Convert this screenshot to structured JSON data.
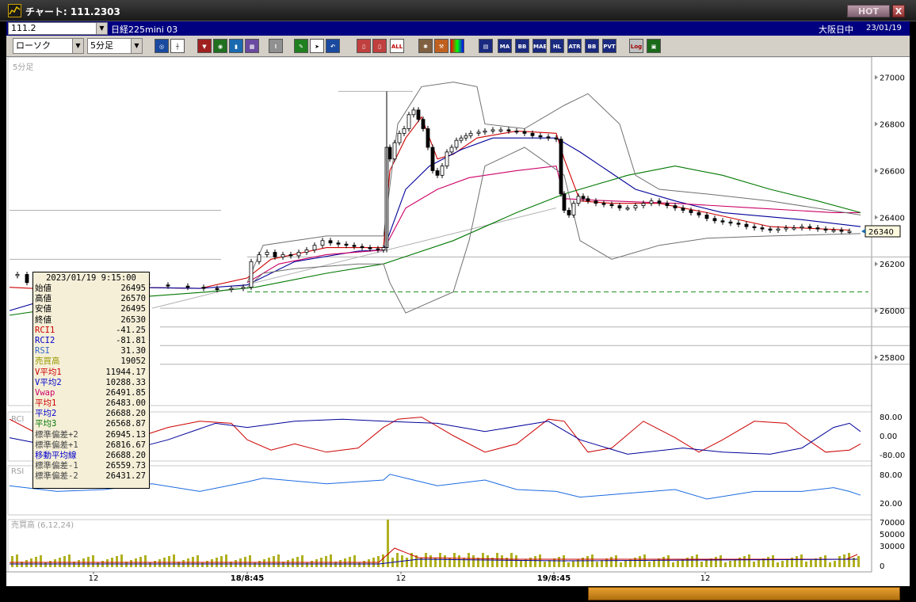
{
  "window": {
    "title": "チャート: 111.2303",
    "hot_label": "HOT",
    "close_label": "X"
  },
  "infobar": {
    "symbol": "111.2",
    "instrument": "日経225mini 03",
    "session": "大阪日中",
    "date": "23/01/19"
  },
  "toolbar": {
    "chart_type": "ローソク",
    "interval": "5分足",
    "buttons": [
      "MA",
      "BB",
      "MAE",
      "HL",
      "ATR",
      "PVT",
      "Log",
      "ALL"
    ]
  },
  "chart_data": {
    "type": "candlestick",
    "interval_label": "5分足",
    "price_axis": {
      "ticks": [
        27000,
        26800,
        26600,
        26400,
        26200,
        26000,
        25800
      ],
      "range": [
        25620,
        27060
      ]
    },
    "last_price": 26340,
    "x_ticks": [
      "12",
      "18/8:45",
      "12",
      "19/8:45",
      "12"
    ],
    "price_path": [
      [
        0,
        26150
      ],
      [
        10,
        26155
      ],
      [
        22,
        26120
      ],
      [
        40,
        26110
      ],
      [
        55,
        26105
      ],
      [
        90,
        26110
      ],
      [
        120,
        26120
      ],
      [
        150,
        26115
      ],
      [
        175,
        26110
      ],
      [
        200,
        26105
      ],
      [
        225,
        26100
      ],
      [
        245,
        26095
      ],
      [
        262,
        26090
      ],
      [
        280,
        26095
      ],
      [
        295,
        26100
      ],
      [
        305,
        26210
      ],
      [
        315,
        26240
      ],
      [
        325,
        26250
      ],
      [
        335,
        26230
      ],
      [
        345,
        26240
      ],
      [
        355,
        26235
      ],
      [
        365,
        26250
      ],
      [
        375,
        26260
      ],
      [
        385,
        26280
      ],
      [
        395,
        26300
      ],
      [
        405,
        26290
      ],
      [
        415,
        26285
      ],
      [
        425,
        26280
      ],
      [
        435,
        26275
      ],
      [
        445,
        26270
      ],
      [
        455,
        26265
      ],
      [
        465,
        26260
      ],
      [
        472,
        26270
      ],
      [
        476,
        26700
      ],
      [
        480,
        26650
      ],
      [
        486,
        26720
      ],
      [
        492,
        26760
      ],
      [
        498,
        26780
      ],
      [
        504,
        26840
      ],
      [
        510,
        26860
      ],
      [
        516,
        26820
      ],
      [
        522,
        26780
      ],
      [
        528,
        26700
      ],
      [
        534,
        26600
      ],
      [
        540,
        26580
      ],
      [
        546,
        26620
      ],
      [
        552,
        26680
      ],
      [
        558,
        26700
      ],
      [
        564,
        26730
      ],
      [
        570,
        26740
      ],
      [
        576,
        26750
      ],
      [
        582,
        26760
      ],
      [
        592,
        26765
      ],
      [
        600,
        26770
      ],
      [
        610,
        26775
      ],
      [
        620,
        26775
      ],
      [
        630,
        26770
      ],
      [
        640,
        26768
      ],
      [
        650,
        26760
      ],
      [
        660,
        26750
      ],
      [
        670,
        26745
      ],
      [
        680,
        26740
      ],
      [
        690,
        26735
      ],
      [
        696,
        26500
      ],
      [
        700,
        26430
      ],
      [
        706,
        26410
      ],
      [
        712,
        26460
      ],
      [
        718,
        26490
      ],
      [
        724,
        26480
      ],
      [
        730,
        26470
      ],
      [
        740,
        26460
      ],
      [
        750,
        26455
      ],
      [
        760,
        26450
      ],
      [
        770,
        26440
      ],
      [
        780,
        26440
      ],
      [
        790,
        26450
      ],
      [
        800,
        26460
      ],
      [
        810,
        26470
      ],
      [
        820,
        26460
      ],
      [
        830,
        26450
      ],
      [
        840,
        26440
      ],
      [
        850,
        26430
      ],
      [
        860,
        26420
      ],
      [
        870,
        26410
      ],
      [
        880,
        26395
      ],
      [
        890,
        26385
      ],
      [
        900,
        26380
      ],
      [
        910,
        26375
      ],
      [
        920,
        26370
      ],
      [
        930,
        26360
      ],
      [
        940,
        26355
      ],
      [
        950,
        26350
      ],
      [
        960,
        26345
      ],
      [
        970,
        26350
      ],
      [
        980,
        26355
      ],
      [
        990,
        26355
      ],
      [
        1000,
        26360
      ],
      [
        1010,
        26355
      ],
      [
        1020,
        26350
      ],
      [
        1030,
        26345
      ],
      [
        1040,
        26345
      ],
      [
        1050,
        26340
      ],
      [
        1060,
        26340
      ]
    ],
    "series": [
      {
        "key": "ma_fast",
        "color": "#cc0000",
        "points": [
          [
            0,
            26100
          ],
          [
            60,
            26090
          ],
          [
            150,
            26100
          ],
          [
            240,
            26095
          ],
          [
            300,
            26140
          ],
          [
            330,
            26220
          ],
          [
            400,
            26270
          ],
          [
            472,
            26270
          ],
          [
            480,
            26600
          ],
          [
            500,
            26740
          ],
          [
            520,
            26830
          ],
          [
            540,
            26650
          ],
          [
            560,
            26670
          ],
          [
            590,
            26740
          ],
          [
            640,
            26770
          ],
          [
            690,
            26760
          ],
          [
            700,
            26650
          ],
          [
            720,
            26470
          ],
          [
            760,
            26460
          ],
          [
            820,
            26460
          ],
          [
            880,
            26420
          ],
          [
            960,
            26360
          ],
          [
            1060,
            26345
          ]
        ]
      },
      {
        "key": "ma_mid",
        "color": "#000099",
        "points": [
          [
            0,
            26000
          ],
          [
            60,
            26060
          ],
          [
            150,
            26100
          ],
          [
            240,
            26095
          ],
          [
            300,
            26110
          ],
          [
            360,
            26210
          ],
          [
            440,
            26255
          ],
          [
            472,
            26260
          ],
          [
            500,
            26520
          ],
          [
            530,
            26620
          ],
          [
            570,
            26690
          ],
          [
            610,
            26740
          ],
          [
            690,
            26740
          ],
          [
            720,
            26680
          ],
          [
            790,
            26520
          ],
          [
            840,
            26470
          ],
          [
            900,
            26420
          ],
          [
            1000,
            26390
          ],
          [
            1074,
            26360
          ]
        ]
      },
      {
        "key": "vwap",
        "color": "#cc0066",
        "points": [
          [
            300,
            26120
          ],
          [
            340,
            26200
          ],
          [
            400,
            26240
          ],
          [
            472,
            26260
          ],
          [
            500,
            26440
          ],
          [
            540,
            26520
          ],
          [
            580,
            26570
          ],
          [
            640,
            26600
          ],
          [
            690,
            26620
          ],
          [
            700,
            26480
          ],
          [
            760,
            26470
          ],
          [
            840,
            26460
          ],
          [
            940,
            26440
          ],
          [
            1040,
            26420
          ],
          [
            1074,
            26420
          ]
        ]
      },
      {
        "key": "ma_slow",
        "color": "#007700",
        "points": [
          [
            0,
            25980
          ],
          [
            80,
            26020
          ],
          [
            170,
            26060
          ],
          [
            250,
            26080
          ],
          [
            310,
            26100
          ],
          [
            400,
            26160
          ],
          [
            472,
            26200
          ],
          [
            560,
            26300
          ],
          [
            640,
            26420
          ],
          [
            700,
            26500
          ],
          [
            780,
            26580
          ],
          [
            840,
            26620
          ],
          [
            900,
            26580
          ],
          [
            960,
            26520
          ],
          [
            1020,
            26470
          ],
          [
            1074,
            26420
          ]
        ]
      },
      {
        "key": "bb_upper",
        "color": "#707070",
        "points": [
          [
            300,
            26120
          ],
          [
            320,
            26280
          ],
          [
            360,
            26300
          ],
          [
            400,
            26320
          ],
          [
            440,
            26320
          ],
          [
            472,
            26320
          ],
          [
            490,
            26800
          ],
          [
            520,
            26960
          ],
          [
            560,
            26980
          ],
          [
            590,
            26960
          ],
          [
            600,
            26800
          ],
          [
            650,
            26780
          ],
          [
            700,
            26880
          ],
          [
            730,
            26930
          ],
          [
            770,
            26800
          ],
          [
            790,
            26580
          ],
          [
            820,
            26520
          ],
          [
            880,
            26500
          ],
          [
            960,
            26470
          ],
          [
            1074,
            26410
          ]
        ]
      },
      {
        "key": "bb_lower",
        "color": "#707070",
        "points": [
          [
            300,
            26100
          ],
          [
            320,
            26160
          ],
          [
            360,
            26180
          ],
          [
            400,
            26190
          ],
          [
            440,
            26200
          ],
          [
            472,
            26200
          ],
          [
            480,
            26120
          ],
          [
            500,
            25990
          ],
          [
            520,
            26020
          ],
          [
            560,
            26080
          ],
          [
            580,
            26300
          ],
          [
            600,
            26620
          ],
          [
            650,
            26700
          ],
          [
            700,
            26580
          ],
          [
            720,
            26300
          ],
          [
            760,
            26220
          ],
          [
            790,
            26250
          ],
          [
            820,
            26280
          ],
          [
            880,
            26310
          ],
          [
            960,
            26320
          ],
          [
            1074,
            26330
          ]
        ]
      }
    ],
    "oscillators": [
      {
        "name": "RCI",
        "axis": [
          "80.00",
          "0.00",
          "-80.00"
        ]
      },
      {
        "name": "RSI",
        "axis": [
          "80.00",
          "20.00"
        ]
      }
    ],
    "rci_red": [
      [
        0,
        0.1
      ],
      [
        40,
        0.5
      ],
      [
        80,
        0.75
      ],
      [
        120,
        0.8
      ],
      [
        160,
        0.55
      ],
      [
        200,
        0.3
      ],
      [
        240,
        0.15
      ],
      [
        280,
        0.2
      ],
      [
        300,
        0.6
      ],
      [
        330,
        0.85
      ],
      [
        360,
        0.7
      ],
      [
        400,
        0.9
      ],
      [
        440,
        0.8
      ],
      [
        472,
        0.3
      ],
      [
        490,
        0.1
      ],
      [
        520,
        0.05
      ],
      [
        560,
        0.5
      ],
      [
        600,
        0.9
      ],
      [
        640,
        0.7
      ],
      [
        680,
        0.1
      ],
      [
        700,
        0.15
      ],
      [
        730,
        0.9
      ],
      [
        760,
        0.8
      ],
      [
        800,
        0.15
      ],
      [
        840,
        0.55
      ],
      [
        870,
        0.9
      ],
      [
        900,
        0.6
      ],
      [
        940,
        0.15
      ],
      [
        980,
        0.2
      ],
      [
        1000,
        0.5
      ],
      [
        1030,
        0.9
      ],
      [
        1060,
        0.85
      ],
      [
        1074,
        0.7
      ]
    ],
    "rci_blue": [
      [
        0,
        0.55
      ],
      [
        80,
        0.85
      ],
      [
        140,
        0.9
      ],
      [
        200,
        0.6
      ],
      [
        260,
        0.2
      ],
      [
        300,
        0.3
      ],
      [
        360,
        0.15
      ],
      [
        420,
        0.1
      ],
      [
        472,
        0.15
      ],
      [
        540,
        0.2
      ],
      [
        600,
        0.4
      ],
      [
        680,
        0.15
      ],
      [
        720,
        0.6
      ],
      [
        780,
        0.95
      ],
      [
        850,
        0.8
      ],
      [
        900,
        0.9
      ],
      [
        960,
        0.95
      ],
      [
        1000,
        0.8
      ],
      [
        1040,
        0.3
      ],
      [
        1060,
        0.2
      ],
      [
        1074,
        0.4
      ]
    ],
    "rsi_line": [
      [
        0,
        0.4
      ],
      [
        60,
        0.55
      ],
      [
        120,
        0.5
      ],
      [
        180,
        0.35
      ],
      [
        240,
        0.55
      ],
      [
        300,
        0.3
      ],
      [
        320,
        0.2
      ],
      [
        400,
        0.35
      ],
      [
        472,
        0.25
      ],
      [
        480,
        0.1
      ],
      [
        500,
        0.2
      ],
      [
        540,
        0.4
      ],
      [
        600,
        0.25
      ],
      [
        640,
        0.5
      ],
      [
        690,
        0.55
      ],
      [
        720,
        0.7
      ],
      [
        780,
        0.6
      ],
      [
        840,
        0.5
      ],
      [
        880,
        0.75
      ],
      [
        940,
        0.55
      ],
      [
        1000,
        0.55
      ],
      [
        1040,
        0.45
      ],
      [
        1060,
        0.55
      ],
      [
        1074,
        0.65
      ]
    ],
    "volume": {
      "label": "売買高 (6,12,24)",
      "axis": [
        "70000",
        "50000",
        "30000",
        "0"
      ],
      "spike_x": 476
    }
  },
  "info_panel": {
    "timestamp": "2023/01/19 9:15:00",
    "rows": [
      {
        "label": "始値",
        "value": "26495",
        "color": "#000000"
      },
      {
        "label": "高値",
        "value": "26570",
        "color": "#000000"
      },
      {
        "label": "安値",
        "value": "26495",
        "color": "#000000"
      },
      {
        "label": "終値",
        "value": "26530",
        "color": "#000000"
      },
      {
        "label": "RCI1",
        "value": "-41.25",
        "color": "#cc0000"
      },
      {
        "label": "RCI2",
        "value": "-81.81",
        "color": "#0000cc"
      },
      {
        "label": "RSI",
        "value": "31.30",
        "color": "#3366cc"
      },
      {
        "label": "売買高",
        "value": "19052",
        "color": "#999900"
      },
      {
        "label": "V平均1",
        "value": "11944.17",
        "color": "#cc0000"
      },
      {
        "label": "V平均2",
        "value": "10288.33",
        "color": "#0000cc"
      },
      {
        "label": "Vwap",
        "value": "26491.85",
        "color": "#cc0066"
      },
      {
        "label": "平均1",
        "value": "26483.00",
        "color": "#cc0000"
      },
      {
        "label": "平均2",
        "value": "26688.20",
        "color": "#0000cc"
      },
      {
        "label": "平均3",
        "value": "26568.87",
        "color": "#007700"
      },
      {
        "label": "標準偏差+2",
        "value": "26945.13",
        "color": "#444444"
      },
      {
        "label": "標準偏差+1",
        "value": "26816.67",
        "color": "#444444"
      },
      {
        "label": "移動平均線",
        "value": "26688.20",
        "color": "#0000cc"
      },
      {
        "label": "標準偏差-1",
        "value": "26559.73",
        "color": "#444444"
      },
      {
        "label": "標準偏差-2",
        "value": "26431.27",
        "color": "#444444"
      }
    ]
  }
}
